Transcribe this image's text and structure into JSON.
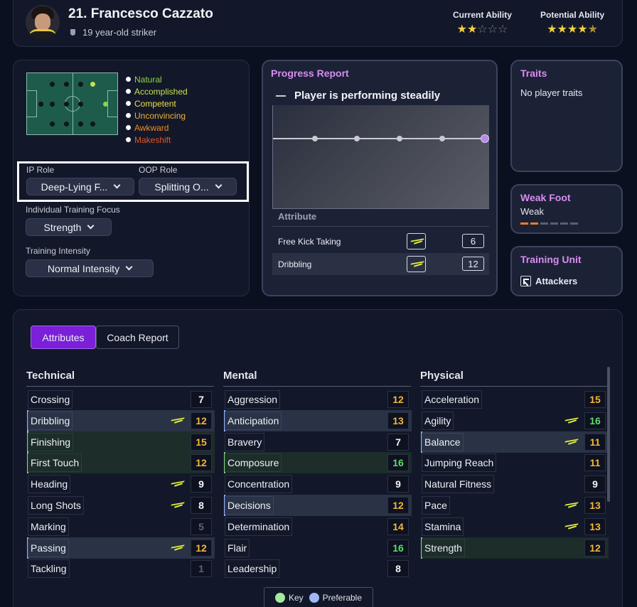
{
  "player": {
    "name": "21. Francesco Cazzato",
    "subtitle": "19 year-old striker"
  },
  "ability": {
    "current_label": "Current Ability",
    "current_stars": 2,
    "current_stars_text": "★★☆☆☆",
    "potential_label": "Potential Ability",
    "potential_stars": 4.5,
    "potential_stars_text": "★★★★★"
  },
  "positions": {
    "legend": [
      {
        "label": "Natural",
        "color": "#8bd44a"
      },
      {
        "label": "Accomplished",
        "color": "#c7e052"
      },
      {
        "label": "Competent",
        "color": "#f0dd4a"
      },
      {
        "label": "Unconvincing",
        "color": "#f0b03a"
      },
      {
        "label": "Awkward",
        "color": "#f08a2a"
      },
      {
        "label": "Makeshift",
        "color": "#e0562a"
      }
    ]
  },
  "roles": {
    "ip_label": "IP Role",
    "ip_value": "Deep-Lying F...",
    "oop_label": "OOP Role",
    "oop_value": "Splitting O...",
    "focus_label": "Individual Training Focus",
    "focus_value": "Strength",
    "intensity_label": "Training Intensity",
    "intensity_value": "Normal Intensity"
  },
  "progress": {
    "title": "Progress Report",
    "status": "Player is performing steadily",
    "attribute_header": "Attribute",
    "rows": [
      {
        "name": "Free Kick Taking",
        "value": "6"
      },
      {
        "name": "Dribbling",
        "value": "12"
      }
    ]
  },
  "traits": {
    "title": "Traits",
    "text": "No player traits"
  },
  "weak_foot": {
    "title": "Weak Foot",
    "value": "Weak",
    "level": 2,
    "max": 6
  },
  "training_unit": {
    "title": "Training Unit",
    "value": "Attackers"
  },
  "attributes": {
    "tabs": [
      "Attributes",
      "Coach Report"
    ],
    "columns": [
      {
        "title": "Technical",
        "rows": [
          {
            "name": "Crossing",
            "value": "7",
            "tone": "white",
            "type": "",
            "pref": false
          },
          {
            "name": "Dribbling",
            "value": "12",
            "tone": "orange",
            "type": "pref",
            "pref": true
          },
          {
            "name": "Finishing",
            "value": "15",
            "tone": "orange",
            "type": "key",
            "pref": false
          },
          {
            "name": "First Touch",
            "value": "12",
            "tone": "orange",
            "type": "key",
            "pref": false
          },
          {
            "name": "Heading",
            "value": "9",
            "tone": "white",
            "type": "",
            "pref": true
          },
          {
            "name": "Long Shots",
            "value": "8",
            "tone": "white",
            "type": "",
            "pref": true
          },
          {
            "name": "Marking",
            "value": "5",
            "tone": "grey",
            "type": "",
            "pref": false
          },
          {
            "name": "Passing",
            "value": "12",
            "tone": "orange",
            "type": "pref",
            "pref": true
          },
          {
            "name": "Tackling",
            "value": "1",
            "tone": "grey",
            "type": "",
            "pref": false
          }
        ]
      },
      {
        "title": "Mental",
        "rows": [
          {
            "name": "Aggression",
            "value": "12",
            "tone": "orange",
            "type": "",
            "pref": false
          },
          {
            "name": "Anticipation",
            "value": "13",
            "tone": "orange",
            "type": "pref",
            "pref": false
          },
          {
            "name": "Bravery",
            "value": "7",
            "tone": "white",
            "type": "",
            "pref": false
          },
          {
            "name": "Composure",
            "value": "16",
            "tone": "green",
            "type": "key",
            "pref": false
          },
          {
            "name": "Concentration",
            "value": "9",
            "tone": "white",
            "type": "",
            "pref": false
          },
          {
            "name": "Decisions",
            "value": "12",
            "tone": "orange",
            "type": "pref",
            "pref": false
          },
          {
            "name": "Determination",
            "value": "14",
            "tone": "orange",
            "type": "",
            "pref": false
          },
          {
            "name": "Flair",
            "value": "16",
            "tone": "green",
            "type": "",
            "pref": false
          },
          {
            "name": "Leadership",
            "value": "8",
            "tone": "white",
            "type": "",
            "pref": false
          }
        ]
      },
      {
        "title": "Physical",
        "rows": [
          {
            "name": "Acceleration",
            "value": "15",
            "tone": "orange",
            "type": "",
            "pref": false
          },
          {
            "name": "Agility",
            "value": "16",
            "tone": "green",
            "type": "",
            "pref": true
          },
          {
            "name": "Balance",
            "value": "11",
            "tone": "orange",
            "type": "pref",
            "pref": true
          },
          {
            "name": "Jumping Reach",
            "value": "11",
            "tone": "orange",
            "type": "",
            "pref": false
          },
          {
            "name": "Natural Fitness",
            "value": "9",
            "tone": "white",
            "type": "",
            "pref": false
          },
          {
            "name": "Pace",
            "value": "13",
            "tone": "orange",
            "type": "",
            "pref": true
          },
          {
            "name": "Stamina",
            "value": "13",
            "tone": "orange",
            "type": "",
            "pref": true
          },
          {
            "name": "Strength",
            "value": "12",
            "tone": "orange",
            "type": "key",
            "pref": false
          }
        ]
      }
    ],
    "key_label": "Key",
    "preferable_label": "Preferable"
  }
}
